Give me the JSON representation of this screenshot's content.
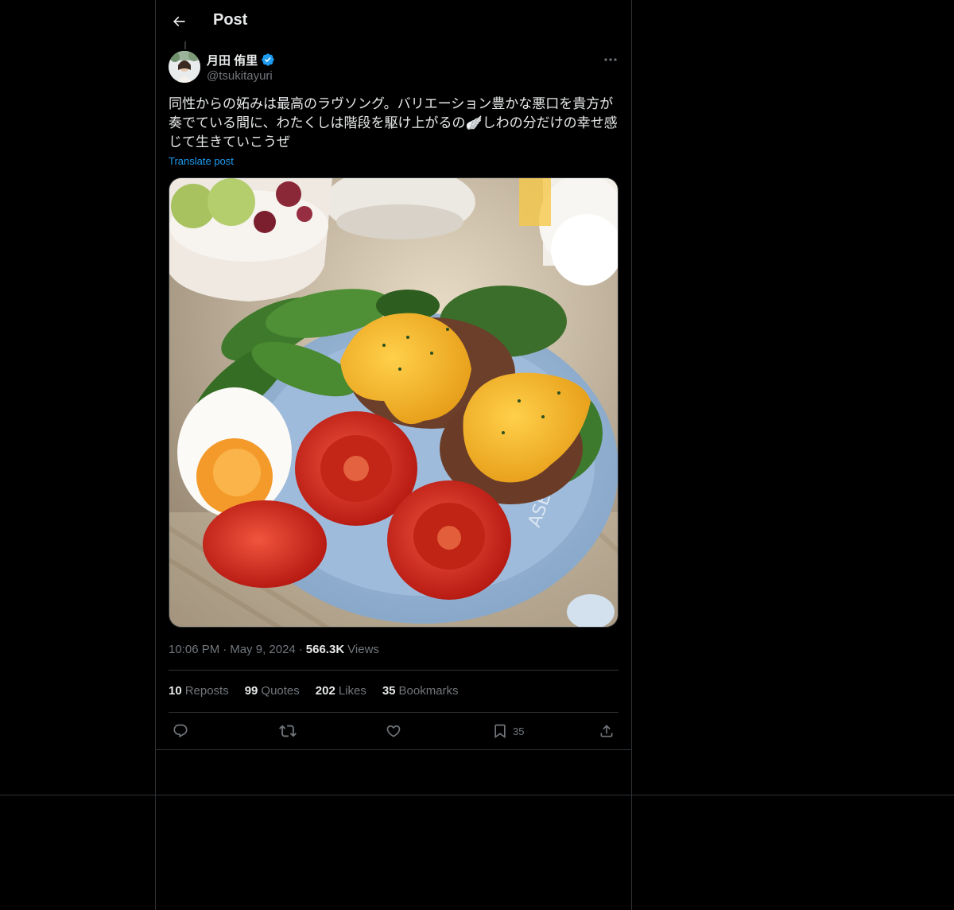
{
  "header": {
    "title": "Post"
  },
  "author": {
    "display_name": "月田 侑里",
    "handle": "@tsukitayuri",
    "verified": true
  },
  "post": {
    "text": "同性からの妬みは最高のラヴソング。バリエーション豊かな悪口を貴方が奏でている間に、わたくしは階段を駆け上がるの🪽しわの分だけの幸せ感じて生きていこうぜ",
    "translate_label": "Translate post"
  },
  "meta": {
    "time": "10:06 PM",
    "dot": "·",
    "date": "May 9, 2024",
    "views_count": "566.3K",
    "views_label": "Views"
  },
  "stats": [
    {
      "count": "10",
      "label": "Reposts"
    },
    {
      "count": "99",
      "label": "Quotes"
    },
    {
      "count": "202",
      "label": "Likes"
    },
    {
      "count": "35",
      "label": "Bookmarks"
    }
  ],
  "actions": {
    "bookmark_count": "35"
  },
  "colors": {
    "accent": "#1d9bf0",
    "background": "#000000",
    "border": "#2f3336",
    "muted": "#71767b",
    "text": "#e7e9ea"
  },
  "icons": [
    "back-arrow-icon",
    "verified-badge-icon",
    "more-icon",
    "reply-icon",
    "repost-icon",
    "like-icon",
    "bookmark-icon",
    "share-icon"
  ]
}
